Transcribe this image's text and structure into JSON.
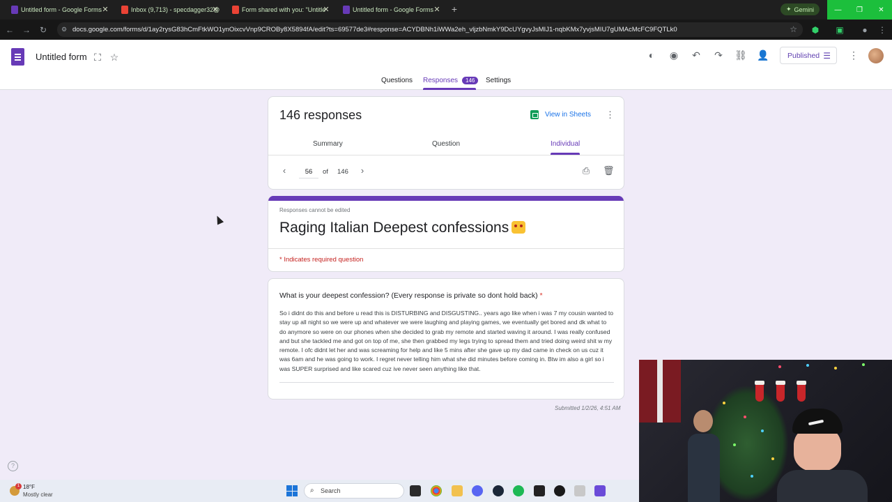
{
  "browser": {
    "tabs": [
      {
        "title": "Untitled form - Google Forms",
        "color": "#673ab7"
      },
      {
        "title": "Inbox (9,713) - specdagger32@",
        "color": "#ea4335"
      },
      {
        "title": "Form shared with you: \"Untitle",
        "color": "#ea4335"
      },
      {
        "title": "Untitled form - Google Forms",
        "color": "#673ab7"
      }
    ],
    "new_tab": "+",
    "gemini_label": "Gemini",
    "url": "docs.google.com/forms/d/1ay2rysG83hCmFtkWO1ynOixcvVnp9CROBy8X5894fA/edit?ts=69577de3#response=ACYDBNh1iWWa2eh_vljzbNmkY9DcUYgvyJsMIJ1-nqbKMx7yvjsMIU7gUMAcMcFC9FQTLk0"
  },
  "forms_header": {
    "form_name": "Untitled form",
    "published_label": "Published",
    "tabs": {
      "questions": "Questions",
      "responses": "Responses",
      "responses_count": "146",
      "settings": "Settings"
    }
  },
  "summary_card": {
    "title": "146 responses",
    "view_in_sheets": "View in Sheets",
    "subtabs": {
      "summary": "Summary",
      "question": "Question",
      "individual": "Individual"
    },
    "pager": {
      "current": "56",
      "of_label": "of",
      "total": "146"
    }
  },
  "form_card": {
    "cannot_edit": "Responses cannot be edited",
    "title": "Raging Italian Deepest confessions",
    "required_note": "* Indicates required question",
    "accent_color": "#673ab7"
  },
  "question_card": {
    "question": "What is your deepest confession? (Every response is private so dont hold back)",
    "required_mark": "*",
    "answer": "So i didnt do this and before u read this is DISTURBING and DISGUSTING.. years ago like when i was 7 my cousin wanted to stay up all night so we were up and whatever we were laughing and playing games, we eventually get bored and dk what to do anymore so were on our phones when she decided to grab my remote and started waving it around. I was really confused and but she tackled me and got on top of me, she then grabbed my legs trying to spread them and tried doing weird shit w my remote. I ofc didnt let her and was screaming for help and like 5 mins after she gave up my dad came in check on us cuz it was 6am and he was going to work. I regret never telling him what she did minutes before coming in. Btw im also a girl so i was SUPER surprised and like scared cuz ive never seen anything like that."
  },
  "submitted": "Submitted 1/2/26, 4:51 AM",
  "taskbar": {
    "weather_temp": "18°F",
    "weather_condition": "Mostly clear",
    "weather_badge": "1",
    "search_label": "Search"
  }
}
